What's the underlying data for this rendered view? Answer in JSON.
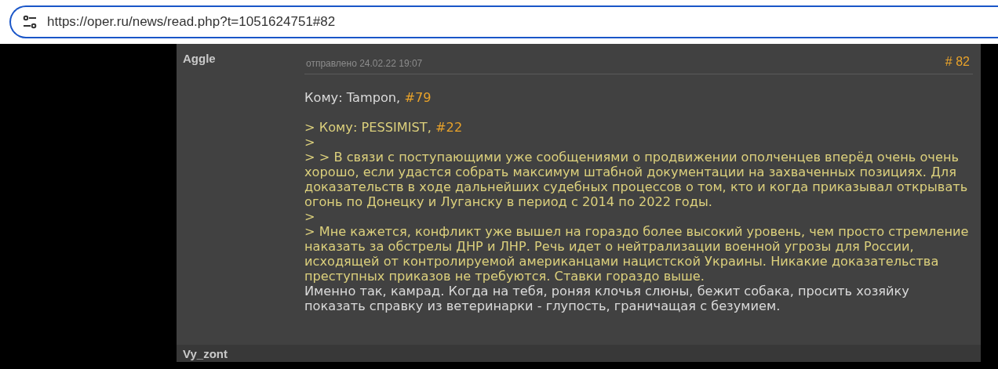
{
  "address_bar": {
    "url": "https://oper.ru/news/read.php?t=1051624751#82"
  },
  "posts": [
    {
      "author": "Aggle",
      "sent": "отправлено 24.02.22 19:07",
      "number": "# 82",
      "lines": [
        {
          "kind": "own",
          "segments": [
            {
              "kind": "text",
              "text": "Кому: Tampon, "
            },
            {
              "kind": "link",
              "text": "#79"
            }
          ]
        },
        {
          "kind": "blank"
        },
        {
          "kind": "quote",
          "segments": [
            {
              "kind": "text",
              "text": "> Кому: PESSIMIST, "
            },
            {
              "kind": "link",
              "text": "#22"
            }
          ]
        },
        {
          "kind": "quote",
          "segments": [
            {
              "kind": "text",
              "text": ">"
            }
          ]
        },
        {
          "kind": "quote",
          "segments": [
            {
              "kind": "text",
              "text": "> > В связи с поступающими уже сообщениями о продвижении ополченцев вперёд очень очень хорошо, если удастся собрать максимум штабной документации на захваченных позициях. Для доказательств в ходе дальнейших судебных процессов о том, кто и когда приказывал открывать огонь по Донецку и Луганску в период с 2014 по 2022 годы."
            }
          ]
        },
        {
          "kind": "quote",
          "segments": [
            {
              "kind": "text",
              "text": ">"
            }
          ]
        },
        {
          "kind": "quote",
          "segments": [
            {
              "kind": "text",
              "text": "> Мне кажется, конфликт уже вышел на гораздо более высокий уровень, чем просто стремление наказать за обстрелы ДНР и ЛНР. Речь идет о нейтрализации военной угрозы для России, исходящей от контролируемой американцами нацистской Украины. Никакие доказательства преступных приказов не требуются. Ставки гораздо выше."
            }
          ]
        },
        {
          "kind": "own",
          "segments": [
            {
              "kind": "text",
              "text": "Именно так, камрад. Когда на тебя, роняя клочья слюны, бежит собака, просить хозяйку показать справку из ветеринарки - глупость, граничащая с безумием."
            }
          ]
        }
      ]
    },
    {
      "author": "Vy_zont"
    }
  ]
}
